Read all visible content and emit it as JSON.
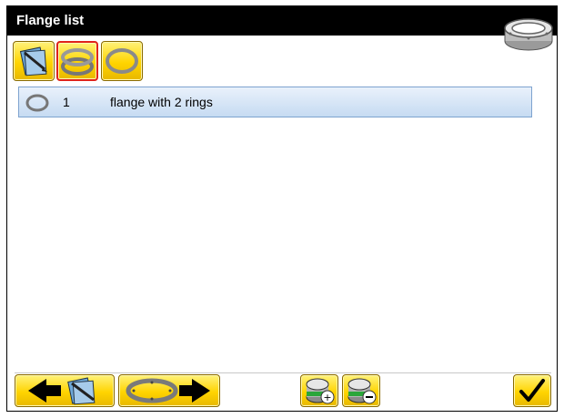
{
  "window": {
    "title": "Flange list",
    "title_icon": "flange-icon"
  },
  "toolbar": {
    "buttons": [
      {
        "icon": "edit-document-icon",
        "selected": false
      },
      {
        "icon": "two-rings-icon",
        "selected": true
      },
      {
        "icon": "single-ring-icon",
        "selected": false
      }
    ]
  },
  "list": {
    "rows": [
      {
        "number": "1",
        "name": "flange with 2 rings",
        "icon": "ring-icon"
      }
    ]
  },
  "footer": {
    "buttons": [
      {
        "icon": "back-arrow-document-icon"
      },
      {
        "icon": "ring-forward-arrow-icon"
      },
      {
        "icon": "add-flange-icon"
      },
      {
        "icon": "remove-flange-icon"
      },
      {
        "icon": "checkmark-icon"
      }
    ]
  },
  "colors": {
    "accent_yellow": "#ffd400",
    "selected_border": "#e0231b",
    "row_blue": "#c6dbf2",
    "titlebar": "#000000"
  }
}
